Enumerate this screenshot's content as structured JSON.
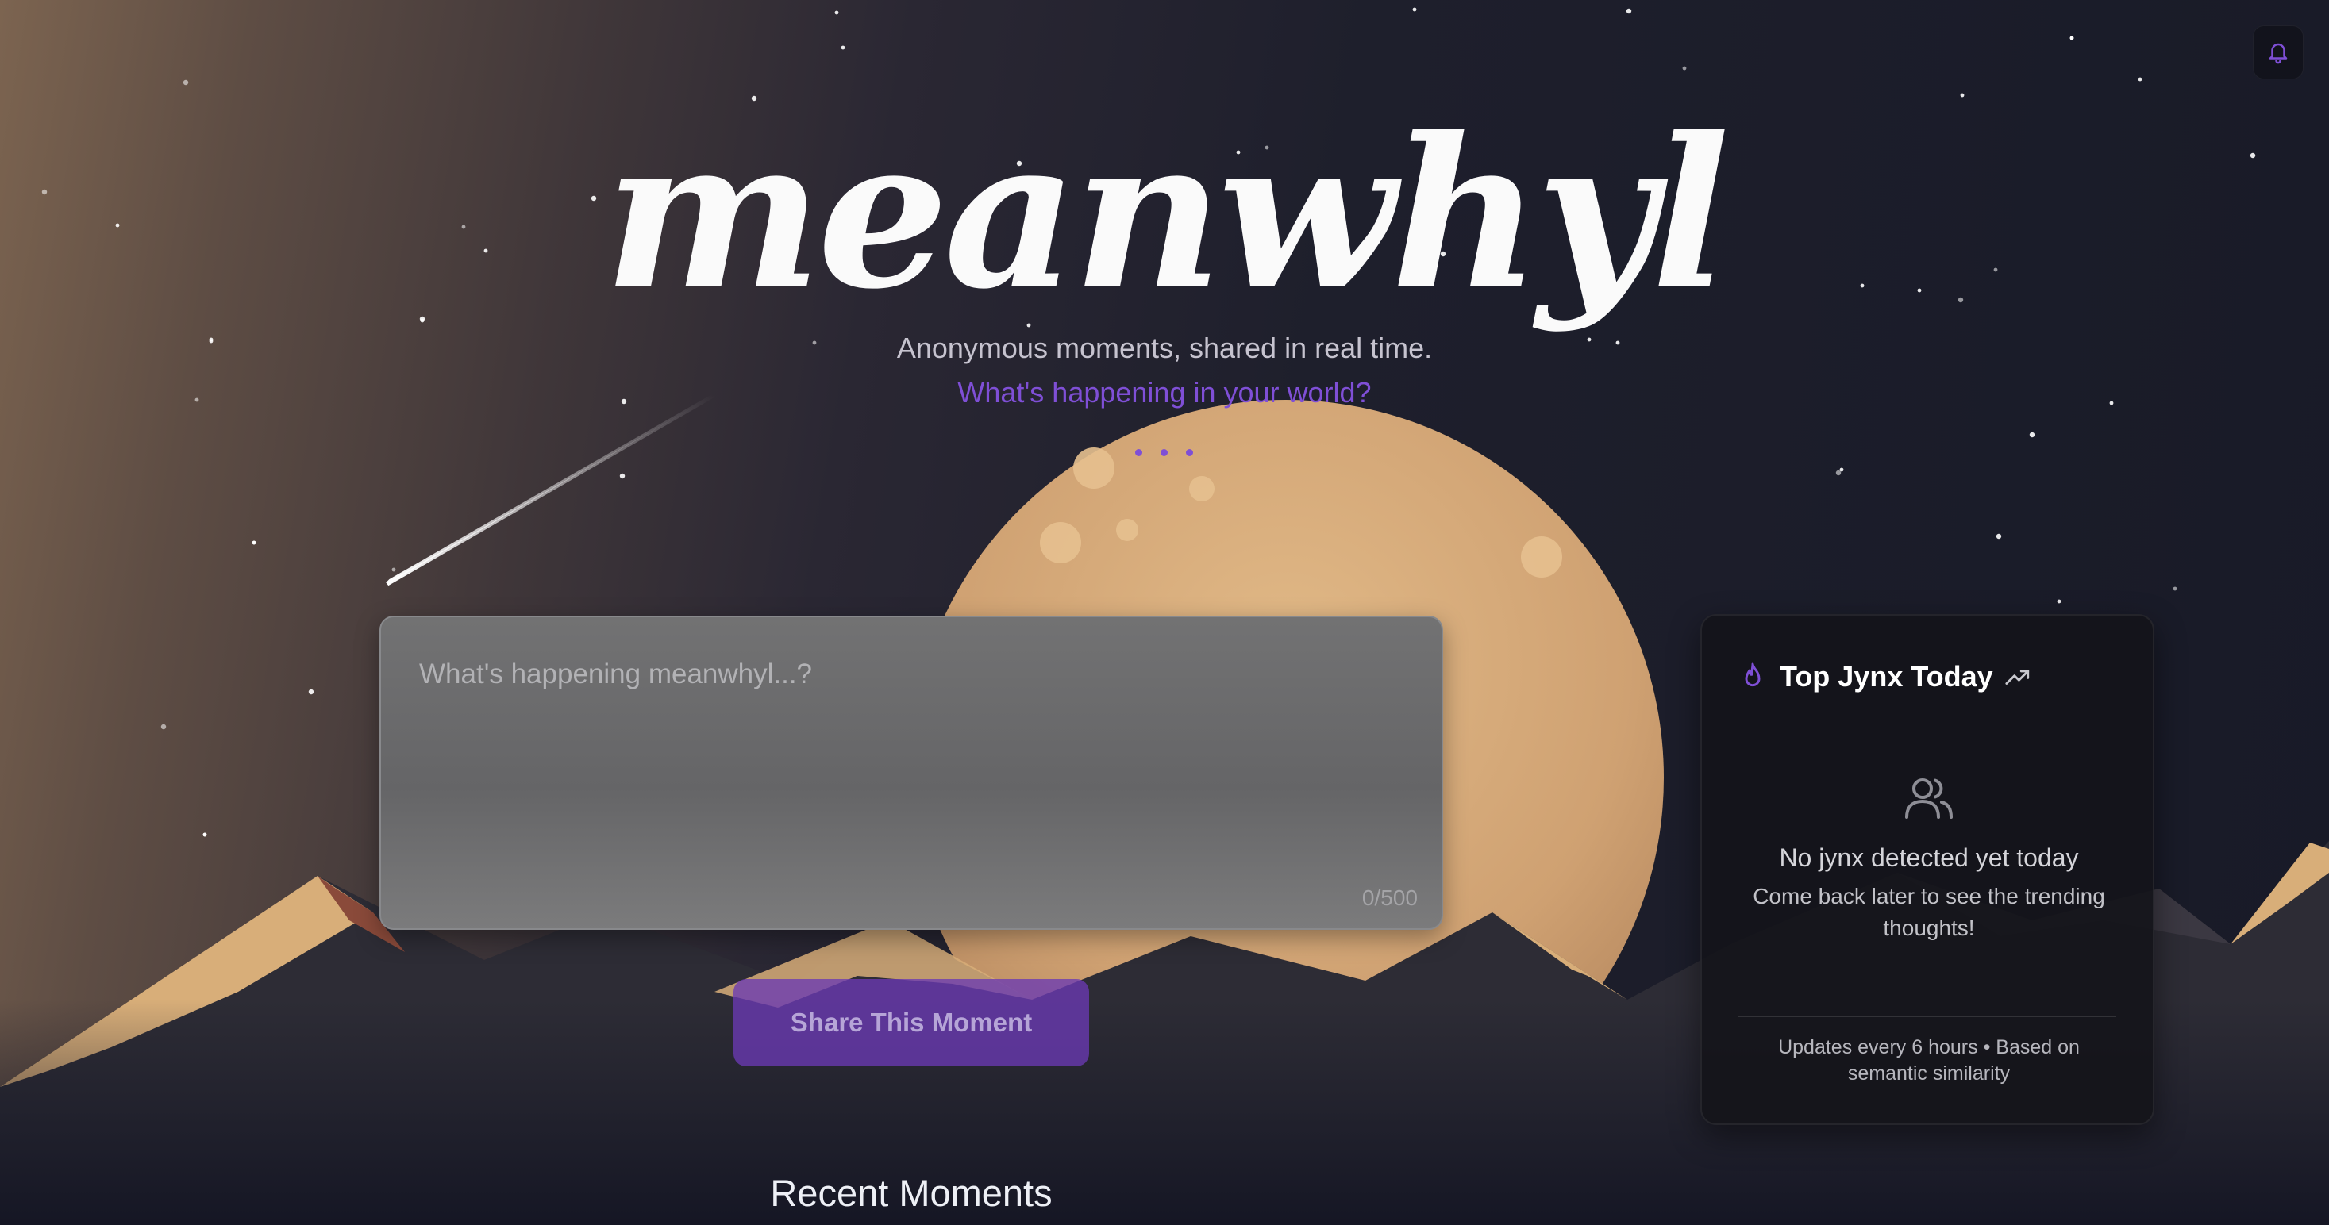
{
  "app": {
    "logo_text": "meanwhyl",
    "subtitle": "Anonymous moments, shared in real time.",
    "tagline": "What's happening in your world?"
  },
  "composer": {
    "placeholder": "What's happening meanwhyl...?",
    "value": "",
    "counter": "0/500",
    "submit_label": "Share This Moment"
  },
  "feed": {
    "heading": "Recent Moments"
  },
  "top_jynx": {
    "title": "Top Jynx Today",
    "empty_title": "No jynx detected yet today",
    "empty_subtitle": "Come back later to see the trending thoughts!",
    "footer": "Updates every 6 hours • Based on semantic similarity",
    "icons": [
      "flame-icon",
      "trending-up-icon",
      "users-icon"
    ]
  },
  "header": {
    "notifications_icon": "bell-icon"
  },
  "colors": {
    "accent": "#7f4fd6",
    "moon": "#d9ae7d",
    "background": "#1b1c2a"
  }
}
